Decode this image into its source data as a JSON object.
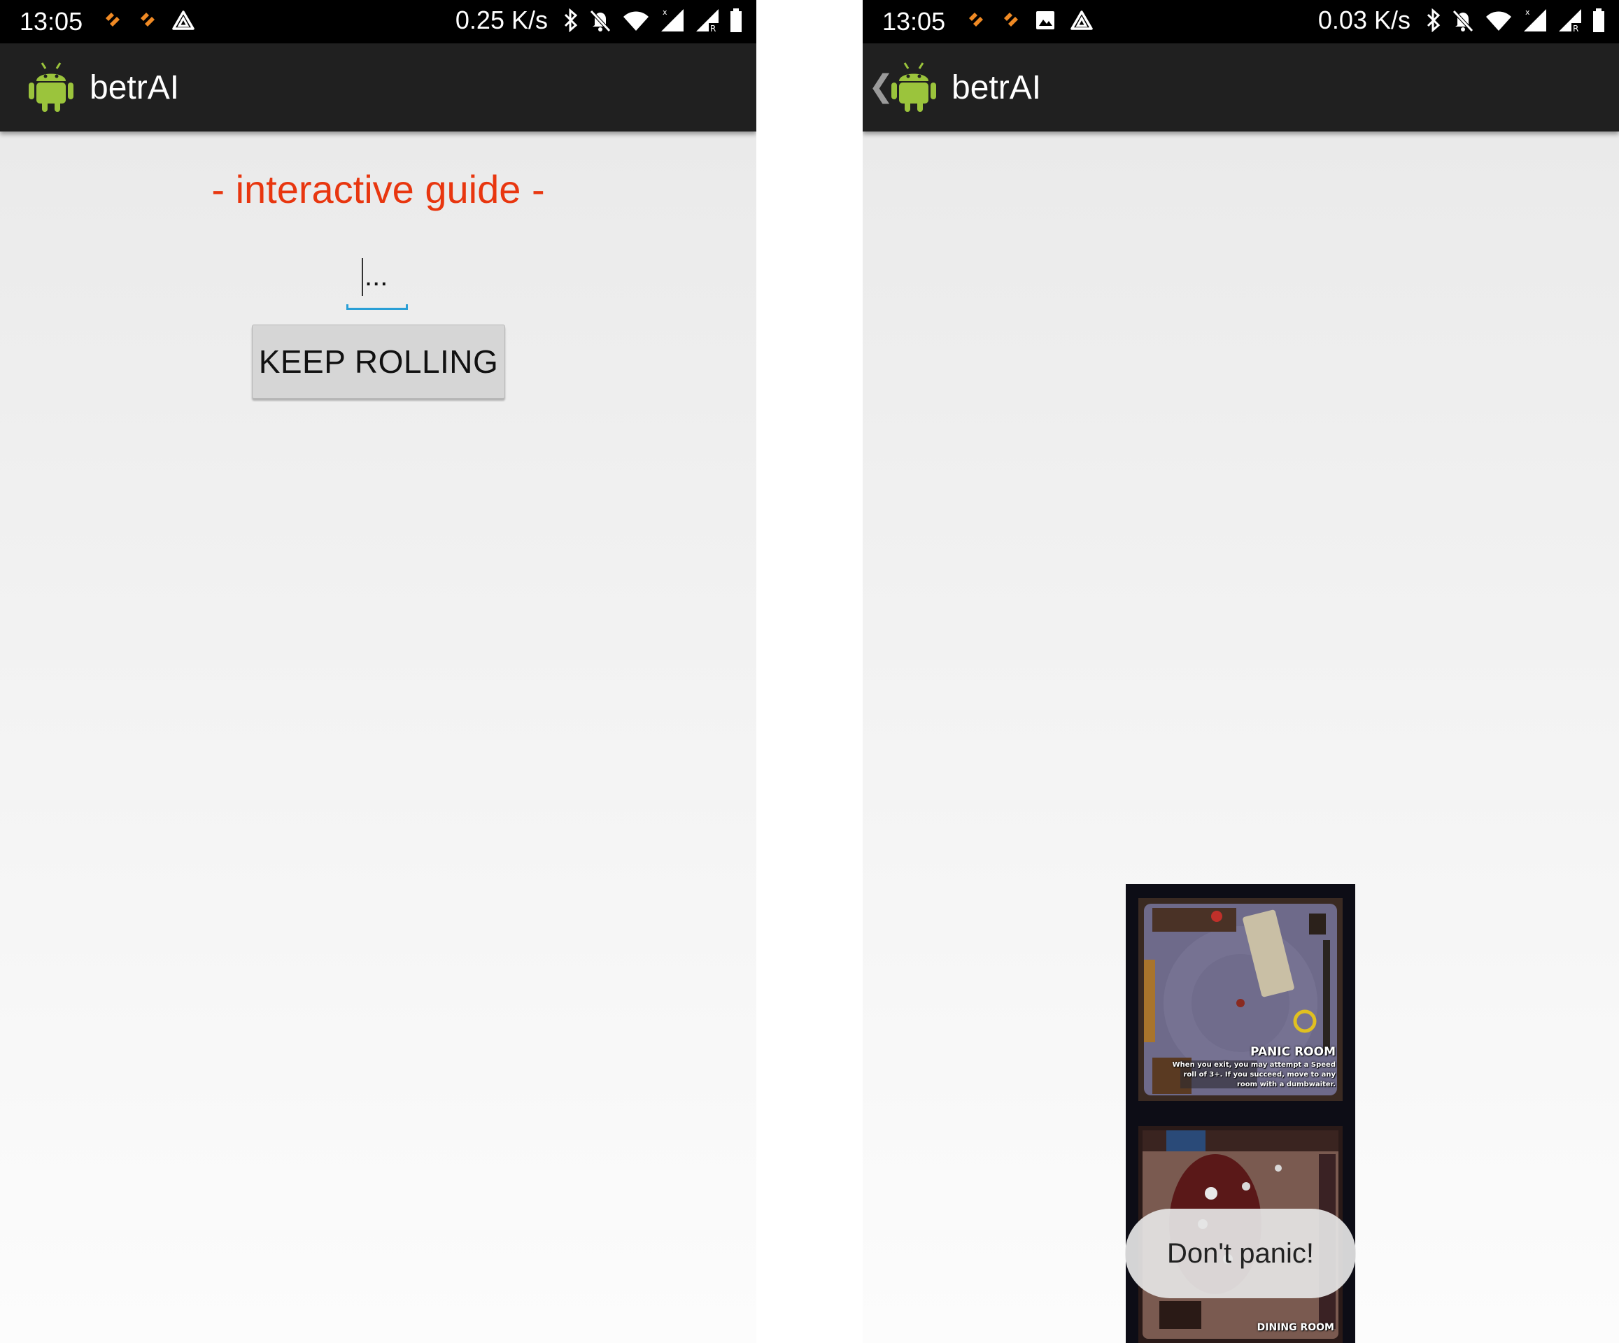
{
  "left_screen": {
    "status_bar": {
      "time": "13:05",
      "net_speed": "0.25 K/s",
      "left_icons": [
        "app-notification-icon",
        "app-notification-icon",
        "drive-icon"
      ],
      "right_icons": [
        "bluetooth-icon",
        "muted-bell-icon",
        "wifi-icon",
        "signal-icon",
        "signal-roaming-icon",
        "battery-icon"
      ]
    },
    "action_bar": {
      "title": "betrAI",
      "icon": "android-logo-icon"
    },
    "content": {
      "guide_title": "- interactive guide -",
      "dots": "...",
      "keep_rolling_label": "KEEP ROLLING"
    }
  },
  "right_screen": {
    "status_bar": {
      "time": "13:05",
      "net_speed": "0.03 K/s",
      "left_icons": [
        "app-notification-icon",
        "app-notification-icon",
        "image-icon",
        "drive-icon"
      ],
      "right_icons": [
        "bluetooth-icon",
        "muted-bell-icon",
        "wifi-icon",
        "signal-icon",
        "signal-roaming-icon",
        "battery-icon"
      ]
    },
    "action_bar": {
      "title": "betrAI",
      "icon": "android-logo-icon",
      "back_icon": "back-chevron-icon"
    },
    "room_tiles": [
      {
        "name": "PANIC ROOM",
        "description": "When you exit, you may attempt a Speed roll of 3+. If you succeed, move to any room with a dumbwaiter."
      },
      {
        "name": "DINING ROOM"
      }
    ],
    "toast": "Don't panic!"
  },
  "colors": {
    "accent_title": "#e8360f",
    "input_underline": "#2a9fd6",
    "action_bar_bg": "#202020",
    "status_bar_bg": "#000000",
    "button_bg": "#d6d6d6",
    "notification_orange": "#f08a24",
    "android_green": "#9bc43c"
  }
}
